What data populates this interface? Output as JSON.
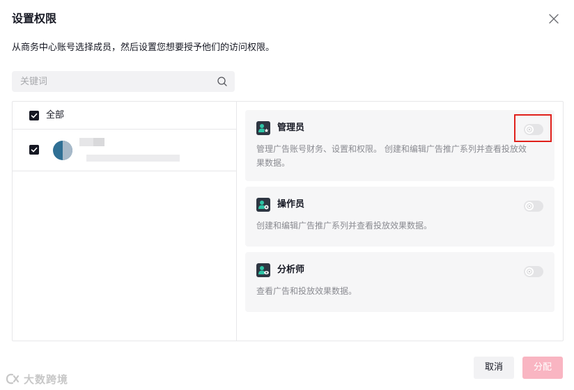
{
  "dialog": {
    "title": "设置权限",
    "subtitle": "从商务中心账号选择成员，然后设置您想要授予他们的访问权限。"
  },
  "search": {
    "placeholder": "关键词"
  },
  "member_list": {
    "select_all_label": "全部",
    "select_all_checked": true,
    "members": [
      {
        "checked": true
      }
    ]
  },
  "roles": [
    {
      "name": "管理员",
      "description": "管理广告账号财务、设置和权限。 创建和编辑广告推广系列并查看投放效果数据。",
      "enabled": false,
      "icon": "user-star-icon"
    },
    {
      "name": "操作员",
      "description": "创建和编辑广告推广系列并查看投放效果数据。",
      "enabled": false,
      "icon": "user-gear-icon"
    },
    {
      "name": "分析师",
      "description": "查看广告和投放效果数据。",
      "enabled": false,
      "icon": "user-eye-icon"
    }
  ],
  "footer": {
    "cancel_label": "取消",
    "assign_label": "分配"
  },
  "watermark": {
    "text": "大数跨境"
  },
  "colors": {
    "accent_disabled": "#f9b5c2",
    "highlight": "#e0201b",
    "checkbox": "#161823"
  }
}
